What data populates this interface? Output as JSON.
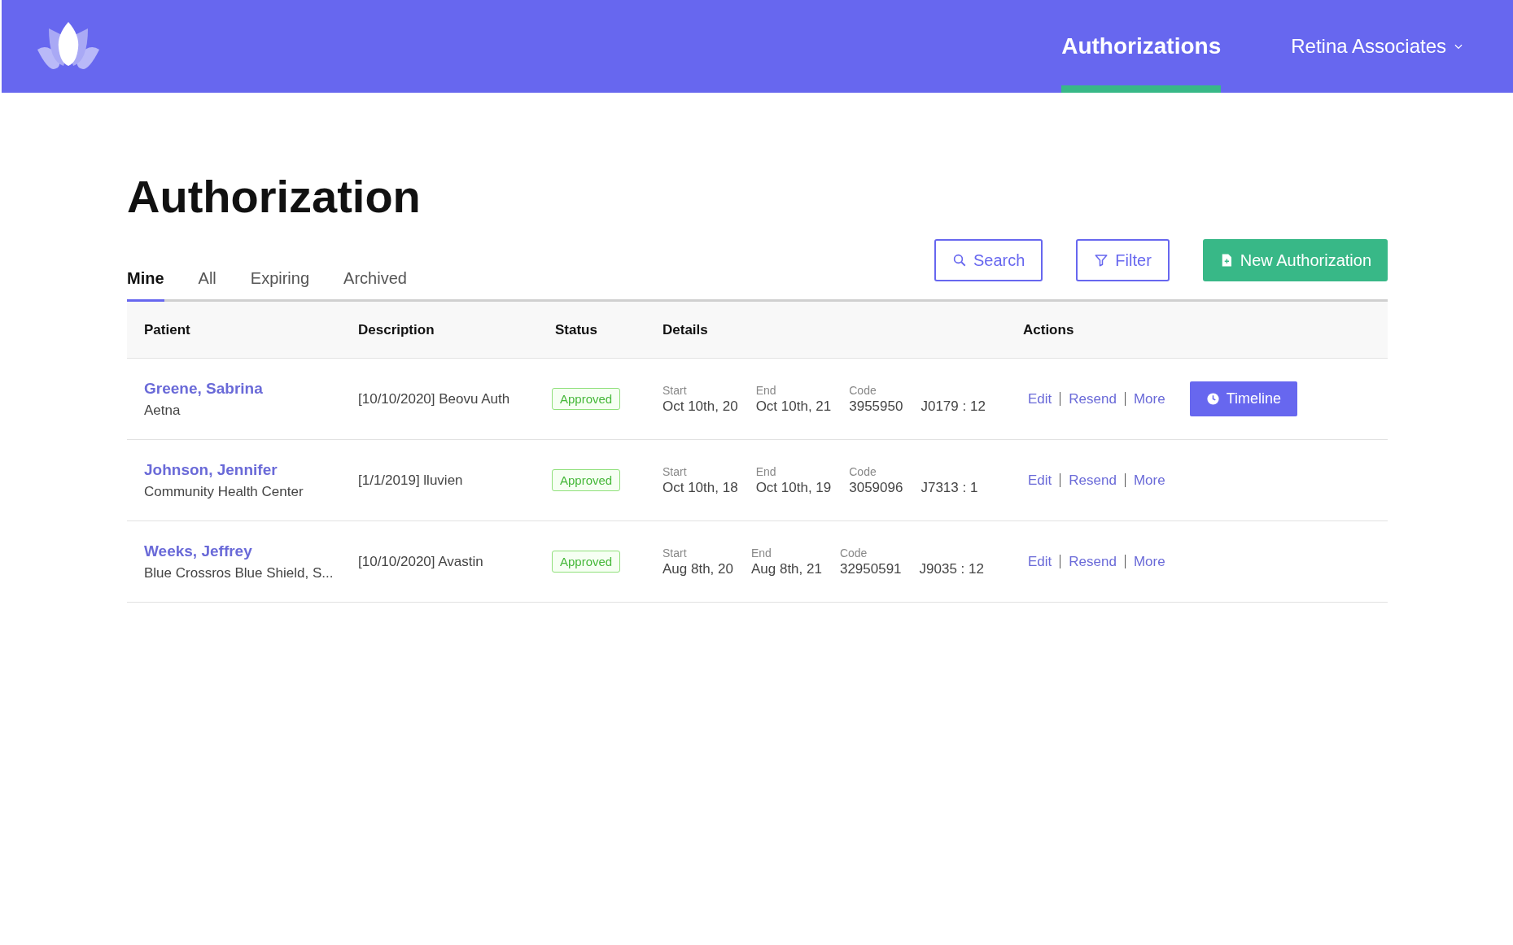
{
  "header": {
    "nav": [
      {
        "label": "Authorizations",
        "selected": true
      }
    ],
    "account": {
      "label": "Retina Associates"
    }
  },
  "page_title": "Authorization",
  "tabs": [
    {
      "label": "Mine",
      "selected": true
    },
    {
      "label": "All",
      "selected": false
    },
    {
      "label": "Expiring",
      "selected": false
    },
    {
      "label": "Archived",
      "selected": false
    }
  ],
  "toolbar": {
    "search": "Search",
    "filter": "Filter",
    "new": "New Authorization"
  },
  "table": {
    "columns": [
      "Patient",
      "Description",
      "Status",
      "Details",
      "Actions"
    ],
    "rows": [
      {
        "patient": "Greene, Sabrina",
        "insurer": "Aetna",
        "description": "[10/10/2020] Beovu Auth",
        "status": "Approved",
        "details": [
          {
            "label": "Start",
            "value": "Oct 10th, 20"
          },
          {
            "label": "End",
            "value": "Oct 10th, 21"
          },
          {
            "label": "Code",
            "value": "3955950"
          },
          {
            "value": "J0179 : 12"
          }
        ],
        "actions": [
          "Edit",
          "Resend",
          "More"
        ],
        "timeline": "Timeline"
      },
      {
        "patient": "Johnson, Jennifer",
        "insurer": "Community Health Center",
        "description": "[1/1/2019] lluvien",
        "status": "Approved",
        "details": [
          {
            "label": "Start",
            "value": "Oct 10th, 18"
          },
          {
            "label": "End",
            "value": "Oct 10th, 19"
          },
          {
            "label": "Code",
            "value": "3059096"
          },
          {
            "value": "J7313 : 1"
          }
        ],
        "actions": [
          "Edit",
          "Resend",
          "More"
        ]
      },
      {
        "patient": "Weeks, Jeffrey",
        "insurer": "Blue Crossros Blue Shield, S...",
        "description": "[10/10/2020] Avastin",
        "status": "Approved",
        "details": [
          {
            "label": "Start",
            "value": "Aug 8th, 20"
          },
          {
            "label": "End",
            "value": "Aug 8th, 21"
          },
          {
            "label": "Code",
            "value": "32950591"
          },
          {
            "value": "J9035 : 12"
          }
        ],
        "actions": [
          "Edit",
          "Resend",
          "More"
        ]
      }
    ]
  }
}
